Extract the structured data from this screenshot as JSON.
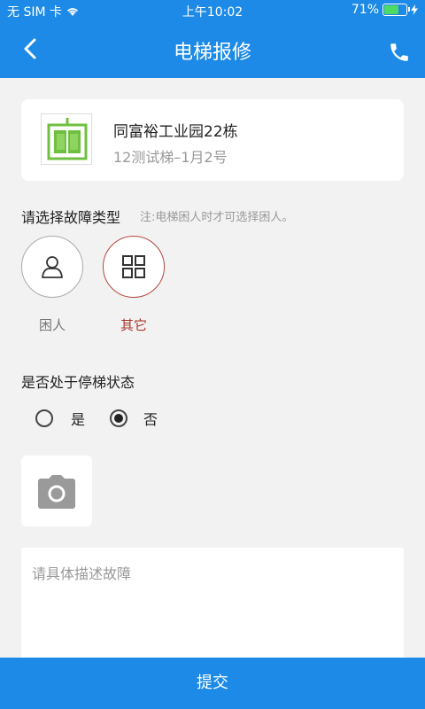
{
  "status_bar": {
    "carrier": "无 SIM 卡",
    "time": "上午10:02",
    "battery_percent": "71%",
    "battery_level": 0.71
  },
  "nav": {
    "title": "电梯报修",
    "back_icon": "chevron-left-icon",
    "phone_icon": "phone-icon"
  },
  "elevator": {
    "name": "同富裕工业园22栋",
    "detail": "12测试梯–1月2号",
    "icon": "elevator-icon"
  },
  "fault_type": {
    "label": "请选择故障类型",
    "note": "注:电梯困人时才可选择困人。",
    "options": [
      {
        "label": "困人",
        "icon": "person-icon",
        "selected": false
      },
      {
        "label": "其它",
        "icon": "grid-icon",
        "selected": true
      }
    ]
  },
  "stopped_state": {
    "label": "是否处于停梯状态",
    "options": [
      {
        "label": "是",
        "checked": false
      },
      {
        "label": "否",
        "checked": true
      }
    ]
  },
  "photo": {
    "icon": "camera-icon"
  },
  "description": {
    "placeholder": "请具体描述故障",
    "value": ""
  },
  "submit_label": "提交",
  "colors": {
    "primary": "#1c8ae6",
    "selected_accent": "#b3463e",
    "elevator_green": "#6fc041"
  }
}
